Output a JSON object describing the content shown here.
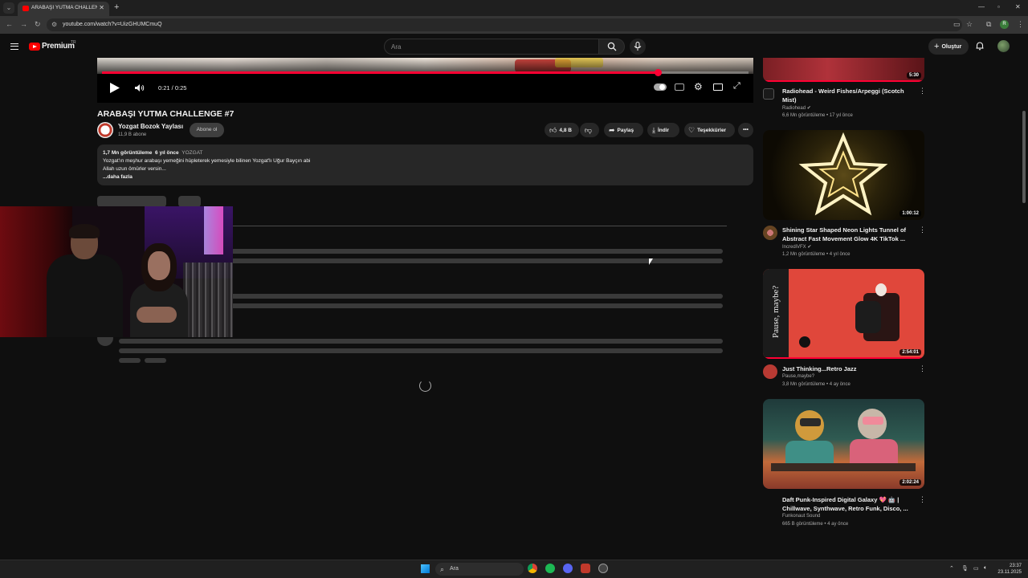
{
  "browser": {
    "tab_title": "ARABAŞI YUTMA CHALLENGE #7",
    "url": "youtube.com/watch?v=UizGHUMCmuQ",
    "profile_initial": "R"
  },
  "masthead": {
    "brand": "Premium",
    "region": "TR",
    "search_placeholder": "Ara",
    "create_label": "Oluştur"
  },
  "player": {
    "time": "0:21 / 0:25",
    "progress": 0.86
  },
  "video": {
    "title": "ARABAŞI YUTMA CHALLENGE #7",
    "channel": "Yozgat Bozok Yaylası",
    "subscribers": "11,9 B abone",
    "subscribe_label": "Abone ol",
    "likes": "4,8 B",
    "share_label": "Paylaş",
    "download_label": "İndir",
    "thanks_label": "Teşekkürler",
    "views": "1,7 Mn görüntüleme",
    "age": "6 yıl önce",
    "hashtag": "YOZGAT",
    "desc_line1": "Yozgat'ın meşhur arabaşı yemeğini hüpleterek yemesiyle bilinen Yozgat'lı Uğur Bayçın abi",
    "desc_line2": "Allah uzun ömürler versin...",
    "more_label": "...daha fazla"
  },
  "recommendations": [
    {
      "title": "Radiohead - Weird Fishes/Arpeggi (Scotch Mist)",
      "channel": "Radiohead",
      "meta": "6,6 Mn görüntüleme • 17 yıl önce",
      "duration": "5:30",
      "verified": true
    },
    {
      "title": "Shining Star Shaped Neon Lights Tunnel of Abstract Fast Movement Glow 4K TikTok ...",
      "channel": "IncrediVFX",
      "meta": "1,2 Mn görüntüleme • 4 yıl önce",
      "duration": "1:00:12",
      "verified": true
    },
    {
      "title": "Just Thinking...Retro Jazz",
      "channel": "Pause,maybe?",
      "meta": "3,8 Mn görüntüleme • 4 ay önce",
      "duration": "2:54:01",
      "thumb_text": "Pause, maybe?",
      "verified": false
    },
    {
      "title": "Daft Punk-Inspired Digital Galaxy 💖 🤖 | Chillwave, Synthwave, Retro Funk, Disco, ...",
      "channel": "Funkonaut Sound",
      "meta": "665 B görüntüleme • 4 ay önce",
      "duration": "2:02:24",
      "verified": false
    }
  ],
  "taskbar": {
    "search_label": "Ara",
    "time": "23:37",
    "date": "23.11.2025"
  },
  "colors": {
    "accent": "#ff0033",
    "background": "#0f0f0f",
    "surface": "#272727"
  }
}
